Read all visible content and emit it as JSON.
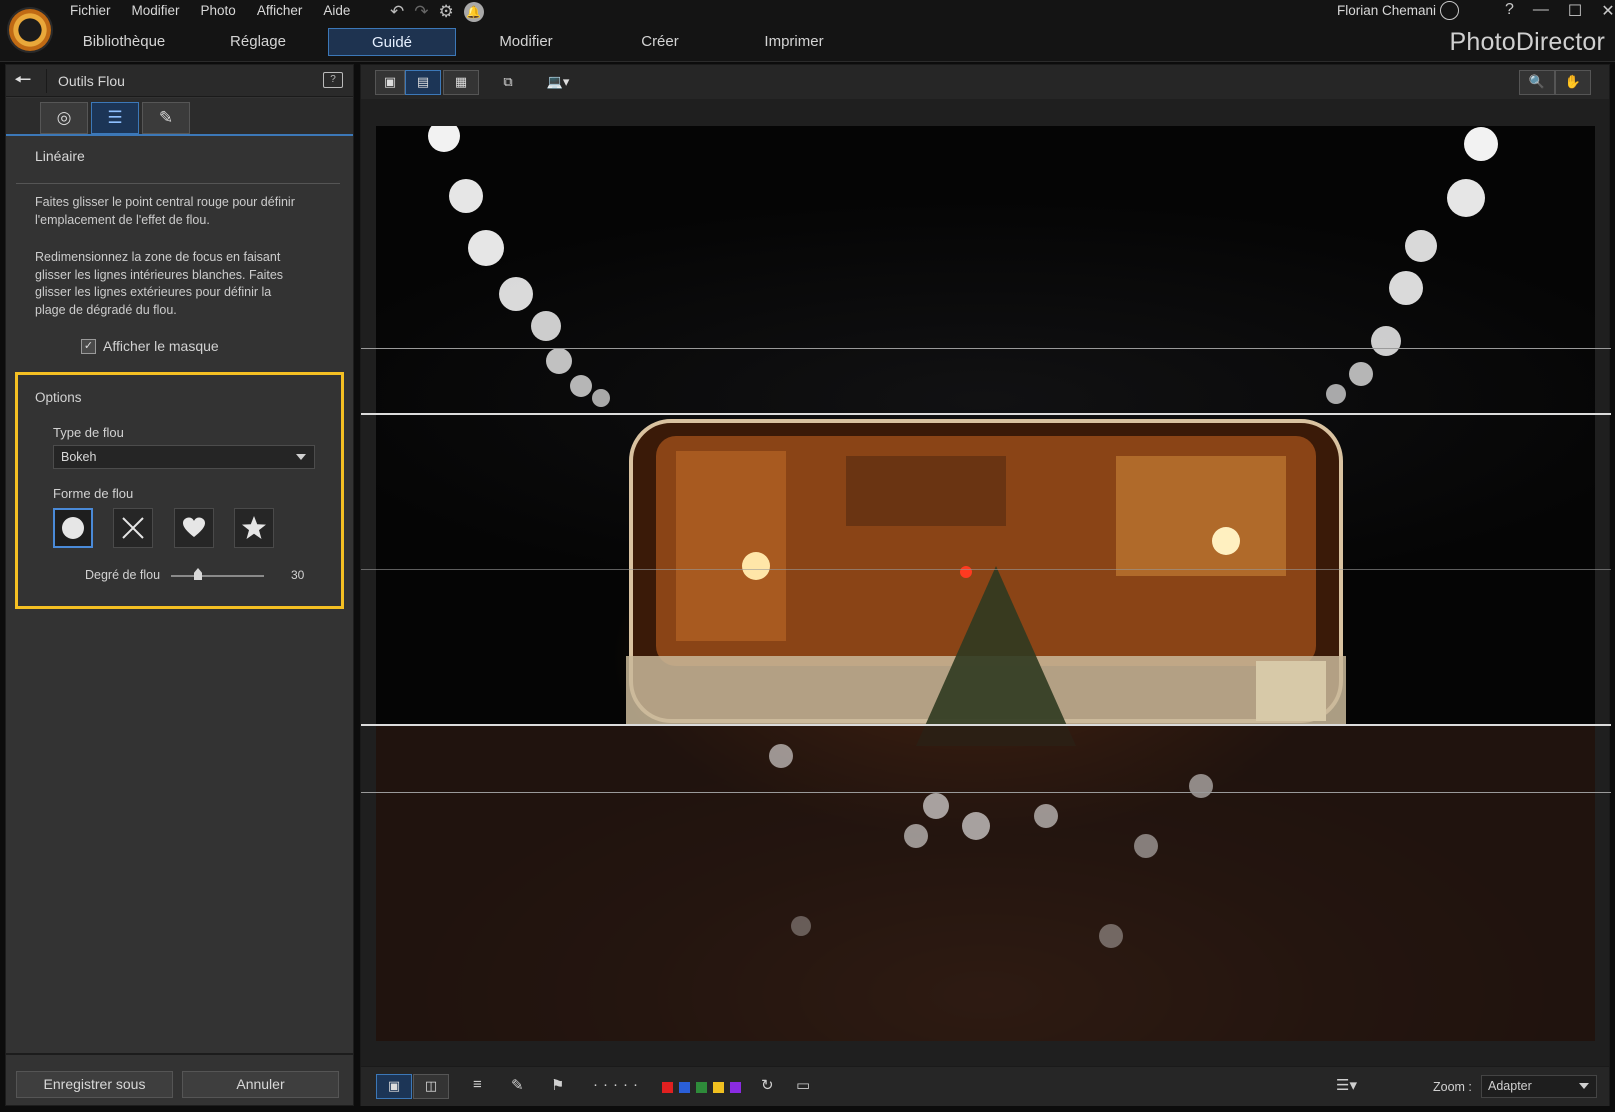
{
  "app": {
    "menu": [
      "Fichier",
      "Modifier",
      "Photo",
      "Afficher",
      "Aide"
    ],
    "user": "Florian Chemani",
    "brand": "PhotoDirector",
    "help": "?"
  },
  "nav": {
    "tabs": [
      "Bibliothèque",
      "Réglage",
      "Guidé",
      "Modifier",
      "Créer",
      "Imprimer"
    ],
    "active": "Guidé"
  },
  "panel": {
    "title": "Outils Flou",
    "section": "Linéaire",
    "desc1": "Faites glisser le point central rouge pour définir l'emplacement de l'effet de flou.",
    "desc2": "Redimensionnez la zone de focus en faisant glisser les lignes intérieures blanches. Faites glisser les lignes extérieures pour définir la plage de dégradé du flou.",
    "mask_label": "Afficher le masque",
    "mask_checked": true,
    "options": {
      "title": "Options",
      "type_label": "Type de flou",
      "type_value": "Bokeh",
      "shape_label": "Forme de flou",
      "shapes": [
        "circle-icon",
        "cross-icon",
        "heart-icon",
        "star-icon"
      ],
      "active_shape": "circle-icon",
      "degree_label": "Degré de flou",
      "degree_value": "30"
    },
    "save_button": "Enregistrer sous",
    "cancel_button": "Annuler"
  },
  "viewer": {
    "zoom_label": "Zoom :",
    "zoom_value": "Adapter",
    "color_labels": [
      "#e02020",
      "#2a5fd8",
      "#2e8b3a",
      "#f0c020",
      "#8a2be2"
    ]
  },
  "colors": {
    "accent": "#3c78b8",
    "highlight": "#f5c023",
    "background": "#0c0c0c"
  }
}
